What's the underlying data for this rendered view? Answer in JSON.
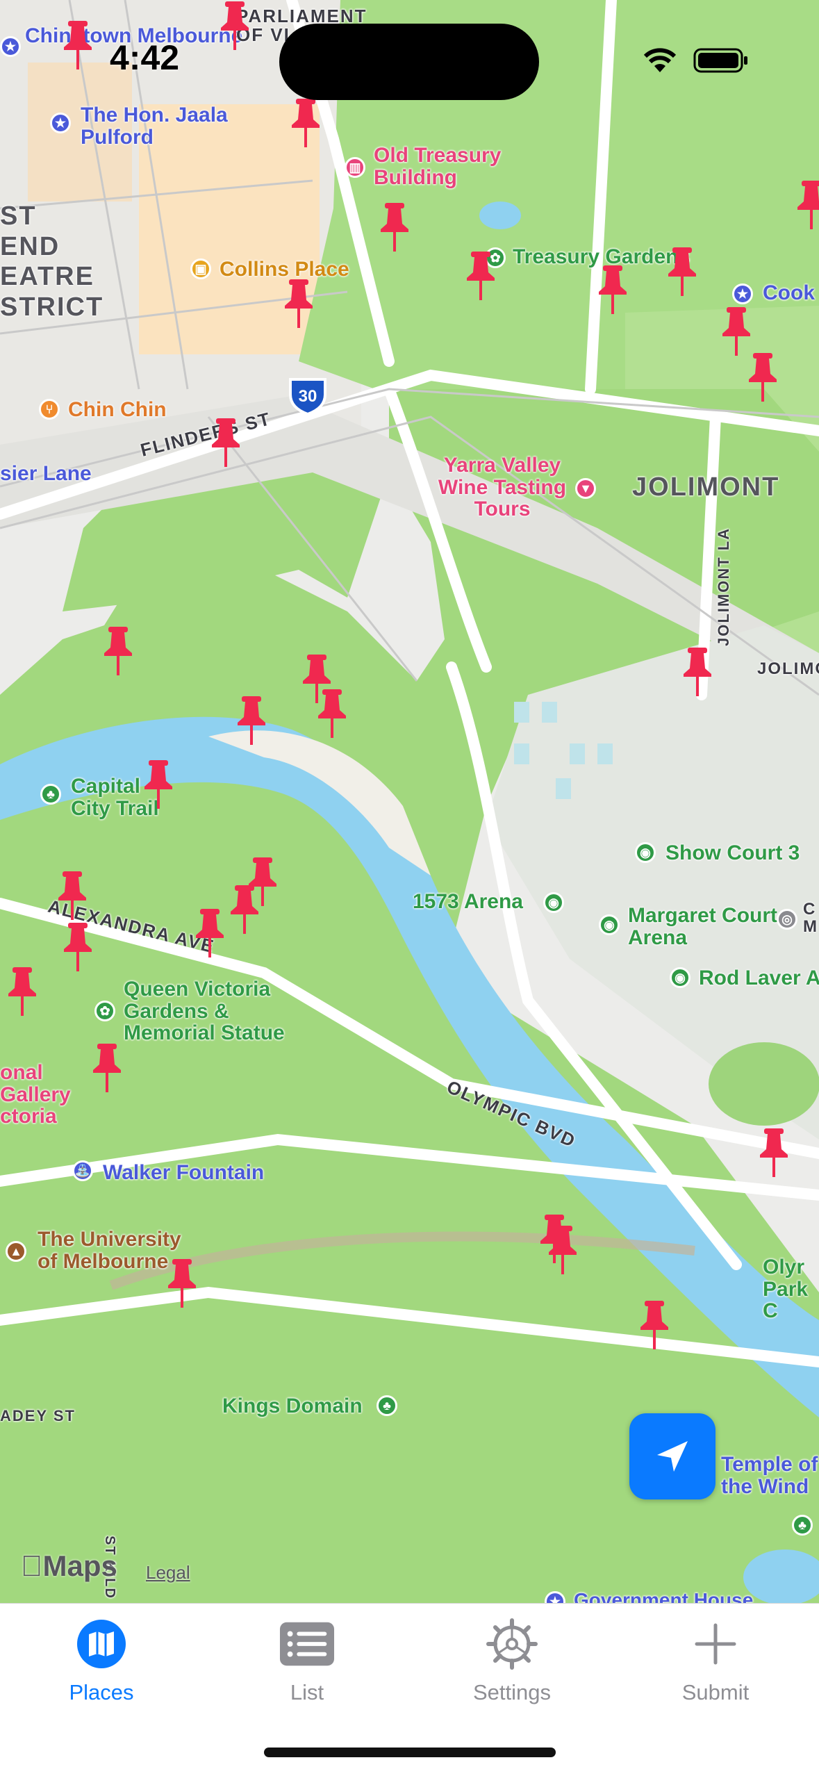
{
  "status_bar": {
    "time": "4:42"
  },
  "map": {
    "labels": {
      "chinatown": "Chinatown Melbourne",
      "hon_jaala": "The Hon. Jaala Pulford",
      "parliament": "PARLIAMENT OF VI",
      "old_treasury": "Old Treasury Building",
      "treasury_gardens": "Treasury Gardens",
      "cook": "Cook",
      "collins_place": "Collins Place",
      "east_end": "ST END EATRE STRICT",
      "chin_chin": "Chin Chin",
      "flinders_st": "FLINDERS ST",
      "sier_lane": "sier Lane",
      "route_30": "30",
      "yarra_valley": "Yarra Valley Wine Tasting Tours",
      "jolimont": "JOLIMONT",
      "jolimont_la": "JOLIMONT LA",
      "jolimo": "JOLIMO",
      "capital_city_trail": "Capital City Trail",
      "show_court": "Show Court 3",
      "arena_1573": "1573 Arena",
      "margaret_court": "Margaret Court Arena",
      "rod_laver": "Rod Laver A",
      "alexandra_ave": "ALEXANDRA AVE",
      "queen_victoria": "Queen Victoria Gardens & Memorial Statue",
      "national_gallery": "onal Gallery ctoria",
      "olympic_bvd": "OLYMPIC BVD",
      "walker_fountain": "Walker Fountain",
      "uni_melbourne": "The University of Melbourne",
      "olympic_park": "Olyr Park C",
      "kings_domain": "Kings Domain",
      "temple_wind": "Temple of the Wind",
      "adey_st": "ADEY ST",
      "st_kilda": "ST KILD",
      "government_house": "Government House",
      "cmv": "C M"
    },
    "attribution": {
      "brand": "Maps",
      "legal": "Legal"
    },
    "pin_color": "#f0284f"
  },
  "tabs": [
    {
      "label": "Places",
      "icon": "map-icon",
      "active": true
    },
    {
      "label": "List",
      "icon": "list-icon",
      "active": false
    },
    {
      "label": "Settings",
      "icon": "gear-icon",
      "active": false
    },
    {
      "label": "Submit",
      "icon": "plus-icon",
      "active": false
    }
  ]
}
